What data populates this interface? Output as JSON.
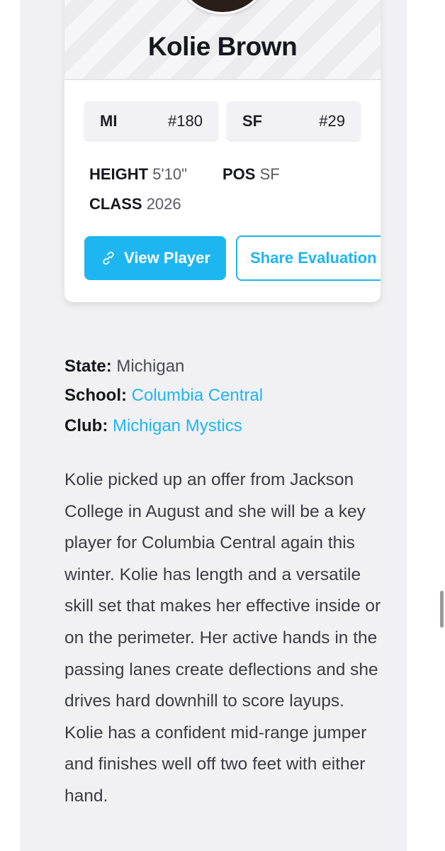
{
  "card": {
    "name": "Kolie Brown",
    "rankings": [
      {
        "label": "MI",
        "rank": "#180"
      },
      {
        "label": "SF",
        "rank": "#29"
      }
    ],
    "stats": {
      "height_label": "HEIGHT",
      "height_value": "5'10\"",
      "pos_label": "POS",
      "pos_value": "SF",
      "class_label": "CLASS",
      "class_value": "2026"
    },
    "view_button": "View Player",
    "share_button": "Share Evaluation"
  },
  "details": {
    "state_label": "State:",
    "state_value": "Michigan",
    "school_label": "School:",
    "school_value": "Columbia Central",
    "club_label": "Club:",
    "club_value": "Michigan Mystics"
  },
  "description": "Kolie picked up an offer from Jackson College in August and she will be a key player for Columbia Central again this winter. Kolie has length and a versatile skill set that makes her effective inside or on the perimeter. Her active hands in the passing lanes create deflections and she drives hard downhill to score layups. Kolie has a confident mid-range jumper and finishes well off two feet with either hand.",
  "colors": {
    "accent": "#1eb6f0",
    "page_bg": "#f1f1f4",
    "card_bg": "#ffffff"
  },
  "icons": {
    "view_button_icon": "link-icon"
  }
}
